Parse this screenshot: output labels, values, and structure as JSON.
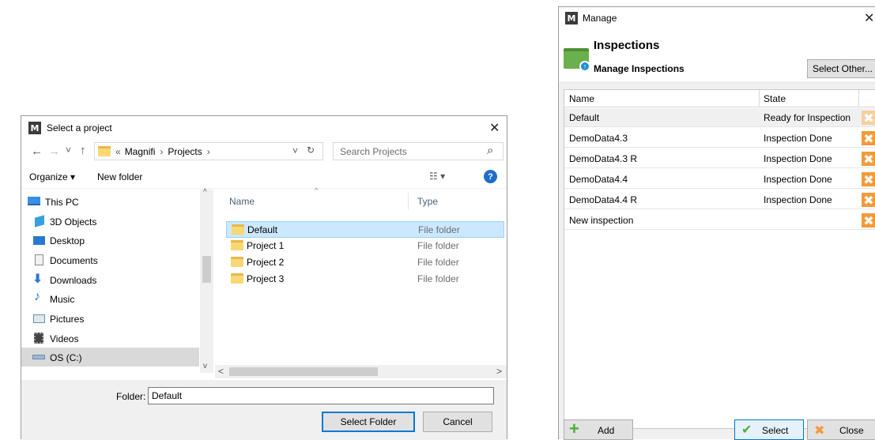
{
  "select_dialog": {
    "title": "Select a project",
    "nav": {
      "back": "←",
      "forward": "→",
      "recent": "˅",
      "up": "↑",
      "breadcrumb_prefix": "«",
      "crumbs": [
        "Magnifi",
        "Projects"
      ],
      "sep": "›",
      "dropdown": "˅",
      "refresh": "↻",
      "search_placeholder": "Search Projects",
      "search_icon": "⌕"
    },
    "toolbar": {
      "organize": "Organize ▾",
      "new_folder": "New folder",
      "view_icon": "☷ ▾",
      "help": "?"
    },
    "sidebar": [
      {
        "label": "This PC",
        "icon": "pc-icon",
        "color": "#3a8ee6"
      },
      {
        "label": "3D Objects",
        "icon": "cube-icon",
        "color": "#39a0e0"
      },
      {
        "label": "Desktop",
        "icon": "desktop-icon",
        "color": "#2b78d0"
      },
      {
        "label": "Documents",
        "icon": "document-icon",
        "color": "#a0a0a0"
      },
      {
        "label": "Downloads",
        "icon": "download-icon",
        "color": "#2b78d0"
      },
      {
        "label": "Music",
        "icon": "music-icon",
        "color": "#2b78d0"
      },
      {
        "label": "Pictures",
        "icon": "pictures-icon",
        "color": "#6a8fb0"
      },
      {
        "label": "Videos",
        "icon": "video-icon",
        "color": "#444"
      },
      {
        "label": "OS (C:)",
        "icon": "drive-icon",
        "color": "#6a8fb0"
      }
    ],
    "columns": {
      "name": "Name",
      "type": "Type"
    },
    "files": [
      {
        "name": "Default",
        "type": "File folder"
      },
      {
        "name": "Project 1",
        "type": "File folder"
      },
      {
        "name": "Project 2",
        "type": "File folder"
      },
      {
        "name": "Project 3",
        "type": "File folder"
      }
    ],
    "folder_label": "Folder:",
    "folder_value": "Default",
    "select_button": "Select Folder",
    "cancel_button": "Cancel"
  },
  "manage_dialog": {
    "title": "Manage",
    "heading": "Inspections",
    "subheading": "Manage Inspections",
    "select_other": "Select Other...",
    "columns": {
      "name": "Name",
      "state": "State"
    },
    "rows": [
      {
        "name": "Default",
        "state": "Ready for Inspection"
      },
      {
        "name": "DemoData4.3",
        "state": "Inspection Done"
      },
      {
        "name": "DemoData4.3 R",
        "state": "Inspection Done"
      },
      {
        "name": "DemoData4.4",
        "state": "Inspection Done"
      },
      {
        "name": "DemoData4.4 R",
        "state": "Inspection Done"
      },
      {
        "name": "New inspection",
        "state": ""
      }
    ],
    "add_button": "Add",
    "select_button": "Select",
    "close_button": "Close"
  },
  "common": {
    "logo": "M",
    "close": "✕",
    "delete_glyph": "✖"
  }
}
